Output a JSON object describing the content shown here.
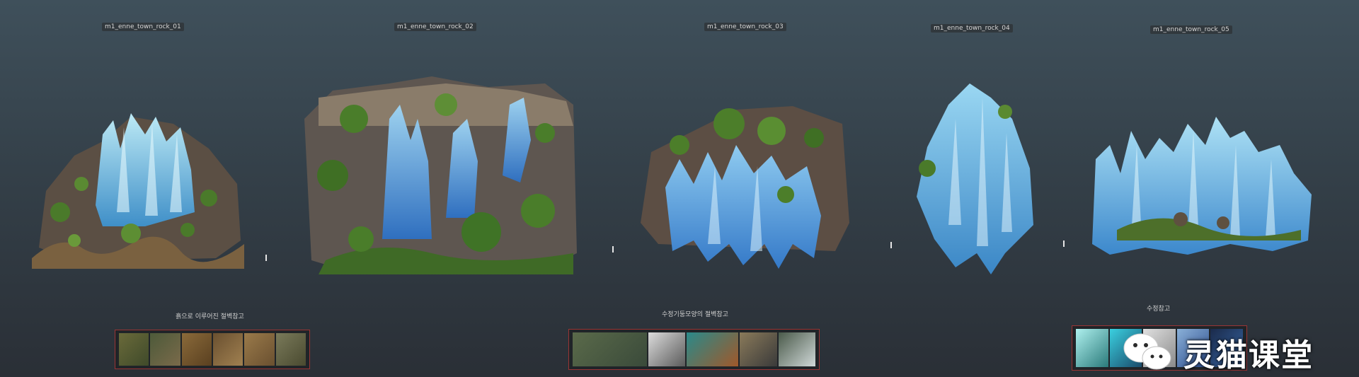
{
  "rocks": [
    {
      "name": "m1_enne_town_rock_01"
    },
    {
      "name": "m1_enne_town_rock_02"
    },
    {
      "name": "m1_enne_town_rock_03"
    },
    {
      "name": "m1_enne_town_rock_04"
    },
    {
      "name": "m1_enne_town_rock_05"
    }
  ],
  "references": [
    {
      "caption": "흙으로 이루어진 절벽참고"
    },
    {
      "caption": "수정기둥모양의 절벽참고"
    },
    {
      "caption": "수정참고"
    }
  ],
  "watermark": {
    "text": "灵猫课堂"
  },
  "colors": {
    "crystal": "#5aa8d8",
    "crystal_light": "#a8e0f0",
    "moss": "#4a7a2a",
    "rock": "#5a5048",
    "strip_border": "#9a3434"
  }
}
